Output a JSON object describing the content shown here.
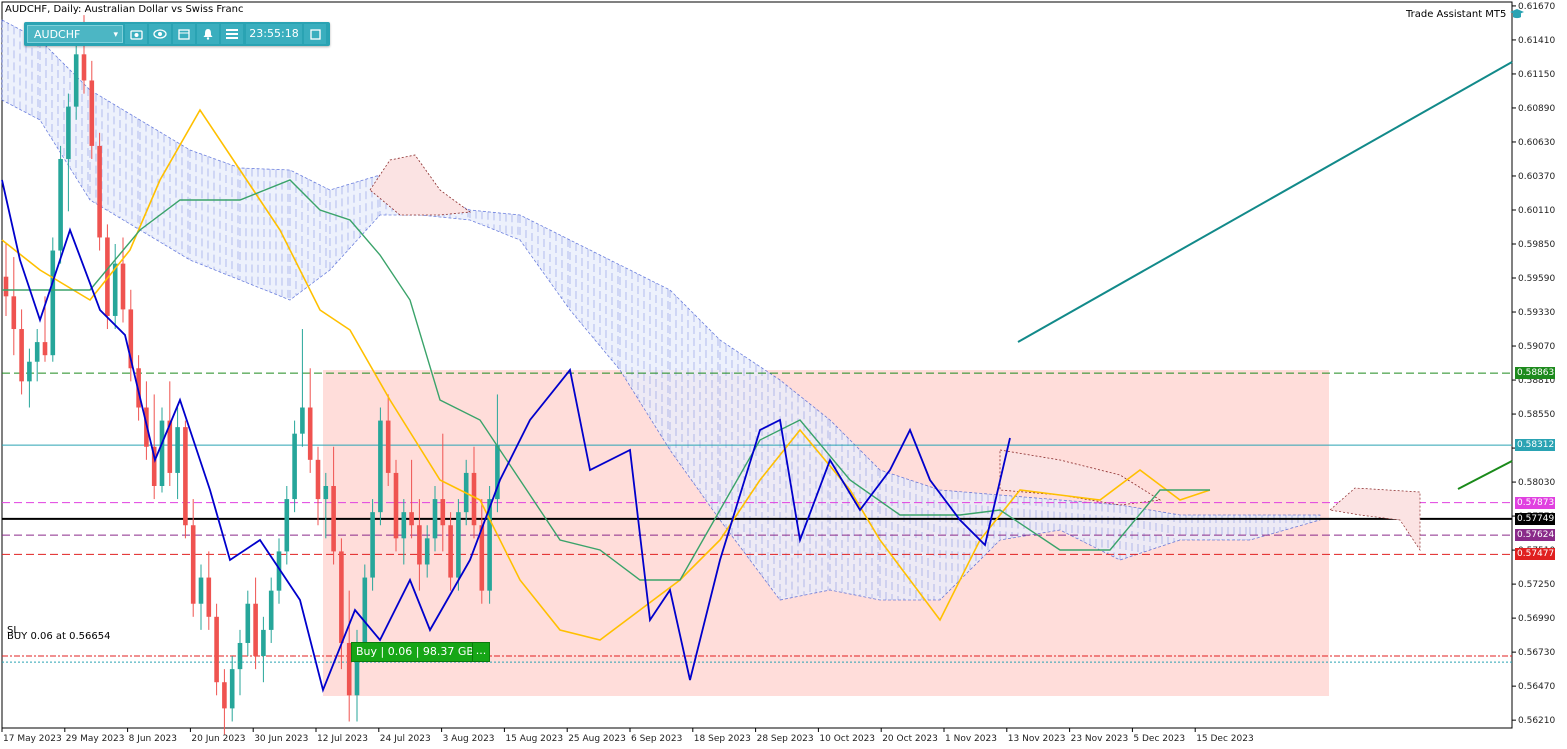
{
  "window_title": "AUDCHF, Daily:  Australian Dollar vs Swiss Franc",
  "toolbar": {
    "symbol": "AUDCHF",
    "clock": "23:55:18",
    "icons": [
      "camera-icon",
      "eye-icon",
      "calendar-icon",
      "bell-icon",
      "menu-icon",
      "window-icon"
    ]
  },
  "trade_assistant": {
    "label": "Trade Assistant MT5"
  },
  "price_axis": {
    "labels": [
      "0.61670",
      "0.61410",
      "0.61150",
      "0.60890",
      "0.60630",
      "0.60370",
      "0.60110",
      "0.59850",
      "0.59590",
      "0.59330",
      "0.59070",
      "0.58810",
      "0.58550",
      "0.58290",
      "0.58030",
      "0.57770",
      "0.57510",
      "0.57250",
      "0.56990",
      "0.56730",
      "0.56470",
      "0.56210"
    ],
    "top_value": 0.617,
    "bottom_value": 0.5615
  },
  "date_axis": {
    "labels": [
      "17 May 2023",
      "29 May 2023",
      "8 Jun 2023",
      "20 Jun 2023",
      "30 Jun 2023",
      "12 Jul 2023",
      "24 Jul 2023",
      "3 Aug 2023",
      "15 Aug 2023",
      "25 Aug 2023",
      "6 Sep 2023",
      "18 Sep 2023",
      "28 Sep 2023",
      "10 Oct 2023",
      "20 Oct 2023",
      "1 Nov 2023",
      "13 Nov 2023",
      "23 Nov 2023",
      "5 Dec 2023",
      "15 Dec 2023"
    ]
  },
  "price_tags": [
    {
      "value": "0.58863",
      "color": "#1d8a1d"
    },
    {
      "value": "0.58312",
      "color": "#2aa3b3"
    },
    {
      "value": "0.57873",
      "color": "#e040e0"
    },
    {
      "value": "0.57749",
      "color": "#000000"
    },
    {
      "value": "0.57624",
      "color": "#8a2a8a"
    },
    {
      "value": "0.57477",
      "color": "#e02020"
    }
  ],
  "order": {
    "sl_label": "SL",
    "buy_line_label": "BUY 0.06 at 0.56654",
    "badge": "Buy | 0.06 | 98.37 GBP",
    "badge_more": "..."
  },
  "colors": {
    "bull": "#26a69a",
    "bear": "#ef5350",
    "tenkan": "#ffc000",
    "kijun": "#3aa36a",
    "chikou": "#0000cc",
    "zone": "#ffd9d6",
    "trend": "#128a8a"
  },
  "chart_data": {
    "type": "candlestick",
    "series": [
      {
        "name": "",
        "values": [
          {
            "o": 0.596,
            "h": 0.5985,
            "l": 0.593,
            "c": 0.5945
          },
          {
            "o": 0.5945,
            "h": 0.5975,
            "l": 0.59,
            "c": 0.592
          },
          {
            "o": 0.592,
            "h": 0.5935,
            "l": 0.587,
            "c": 0.588
          },
          {
            "o": 0.588,
            "h": 0.5905,
            "l": 0.586,
            "c": 0.5895
          },
          {
            "o": 0.5895,
            "h": 0.592,
            "l": 0.588,
            "c": 0.591
          },
          {
            "o": 0.591,
            "h": 0.5945,
            "l": 0.5895,
            "c": 0.59
          },
          {
            "o": 0.59,
            "h": 0.599,
            "l": 0.5895,
            "c": 0.598
          },
          {
            "o": 0.598,
            "h": 0.606,
            "l": 0.597,
            "c": 0.605
          },
          {
            "o": 0.605,
            "h": 0.61,
            "l": 0.601,
            "c": 0.609
          },
          {
            "o": 0.609,
            "h": 0.614,
            "l": 0.608,
            "c": 0.613
          },
          {
            "o": 0.613,
            "h": 0.616,
            "l": 0.61,
            "c": 0.611
          },
          {
            "o": 0.611,
            "h": 0.6125,
            "l": 0.605,
            "c": 0.606
          },
          {
            "o": 0.606,
            "h": 0.607,
            "l": 0.598,
            "c": 0.599
          },
          {
            "o": 0.599,
            "h": 0.6,
            "l": 0.592,
            "c": 0.593
          },
          {
            "o": 0.593,
            "h": 0.5985,
            "l": 0.592,
            "c": 0.597
          },
          {
            "o": 0.597,
            "h": 0.599,
            "l": 0.5925,
            "c": 0.5935
          },
          {
            "o": 0.5935,
            "h": 0.595,
            "l": 0.588,
            "c": 0.589
          },
          {
            "o": 0.589,
            "h": 0.59,
            "l": 0.585,
            "c": 0.586
          },
          {
            "o": 0.586,
            "h": 0.588,
            "l": 0.582,
            "c": 0.583
          },
          {
            "o": 0.583,
            "h": 0.587,
            "l": 0.579,
            "c": 0.58
          },
          {
            "o": 0.58,
            "h": 0.586,
            "l": 0.5795,
            "c": 0.585
          },
          {
            "o": 0.585,
            "h": 0.588,
            "l": 0.58,
            "c": 0.581
          },
          {
            "o": 0.581,
            "h": 0.586,
            "l": 0.579,
            "c": 0.5845
          },
          {
            "o": 0.5845,
            "h": 0.585,
            "l": 0.576,
            "c": 0.577
          },
          {
            "o": 0.577,
            "h": 0.579,
            "l": 0.57,
            "c": 0.571
          },
          {
            "o": 0.571,
            "h": 0.574,
            "l": 0.569,
            "c": 0.573
          },
          {
            "o": 0.573,
            "h": 0.575,
            "l": 0.569,
            "c": 0.57
          },
          {
            "o": 0.57,
            "h": 0.571,
            "l": 0.564,
            "c": 0.565
          },
          {
            "o": 0.565,
            "h": 0.566,
            "l": 0.561,
            "c": 0.563
          },
          {
            "o": 0.563,
            "h": 0.567,
            "l": 0.562,
            "c": 0.566
          },
          {
            "o": 0.566,
            "h": 0.569,
            "l": 0.564,
            "c": 0.568
          },
          {
            "o": 0.568,
            "h": 0.572,
            "l": 0.567,
            "c": 0.571
          },
          {
            "o": 0.571,
            "h": 0.573,
            "l": 0.566,
            "c": 0.567
          },
          {
            "o": 0.567,
            "h": 0.57,
            "l": 0.565,
            "c": 0.569
          },
          {
            "o": 0.569,
            "h": 0.573,
            "l": 0.568,
            "c": 0.572
          },
          {
            "o": 0.572,
            "h": 0.576,
            "l": 0.571,
            "c": 0.575
          },
          {
            "o": 0.575,
            "h": 0.58,
            "l": 0.574,
            "c": 0.579
          },
          {
            "o": 0.579,
            "h": 0.585,
            "l": 0.578,
            "c": 0.584
          },
          {
            "o": 0.584,
            "h": 0.592,
            "l": 0.583,
            "c": 0.586
          },
          {
            "o": 0.586,
            "h": 0.589,
            "l": 0.581,
            "c": 0.582
          },
          {
            "o": 0.582,
            "h": 0.583,
            "l": 0.577,
            "c": 0.579
          },
          {
            "o": 0.579,
            "h": 0.581,
            "l": 0.576,
            "c": 0.58
          },
          {
            "o": 0.58,
            "h": 0.583,
            "l": 0.574,
            "c": 0.575
          },
          {
            "o": 0.575,
            "h": 0.576,
            "l": 0.566,
            "c": 0.568
          },
          {
            "o": 0.568,
            "h": 0.572,
            "l": 0.562,
            "c": 0.564
          },
          {
            "o": 0.564,
            "h": 0.569,
            "l": 0.562,
            "c": 0.568
          },
          {
            "o": 0.568,
            "h": 0.574,
            "l": 0.567,
            "c": 0.573
          },
          {
            "o": 0.573,
            "h": 0.579,
            "l": 0.572,
            "c": 0.578
          },
          {
            "o": 0.578,
            "h": 0.586,
            "l": 0.577,
            "c": 0.585
          },
          {
            "o": 0.585,
            "h": 0.587,
            "l": 0.58,
            "c": 0.581
          },
          {
            "o": 0.581,
            "h": 0.582,
            "l": 0.575,
            "c": 0.576
          },
          {
            "o": 0.576,
            "h": 0.579,
            "l": 0.574,
            "c": 0.578
          },
          {
            "o": 0.578,
            "h": 0.582,
            "l": 0.576,
            "c": 0.577
          },
          {
            "o": 0.577,
            "h": 0.579,
            "l": 0.572,
            "c": 0.574
          },
          {
            "o": 0.574,
            "h": 0.577,
            "l": 0.573,
            "c": 0.576
          },
          {
            "o": 0.576,
            "h": 0.58,
            "l": 0.575,
            "c": 0.579
          },
          {
            "o": 0.579,
            "h": 0.584,
            "l": 0.575,
            "c": 0.577
          },
          {
            "o": 0.577,
            "h": 0.578,
            "l": 0.572,
            "c": 0.573
          },
          {
            "o": 0.573,
            "h": 0.579,
            "l": 0.572,
            "c": 0.578
          },
          {
            "o": 0.578,
            "h": 0.582,
            "l": 0.577,
            "c": 0.581
          },
          {
            "o": 0.581,
            "h": 0.583,
            "l": 0.576,
            "c": 0.577
          },
          {
            "o": 0.577,
            "h": 0.579,
            "l": 0.571,
            "c": 0.572
          },
          {
            "o": 0.572,
            "h": 0.58,
            "l": 0.571,
            "c": 0.579
          },
          {
            "o": 0.579,
            "h": 0.587,
            "l": 0.578,
            "c": 0.5831
          }
        ]
      }
    ],
    "ylim": [
      0.5615,
      0.617
    ]
  }
}
